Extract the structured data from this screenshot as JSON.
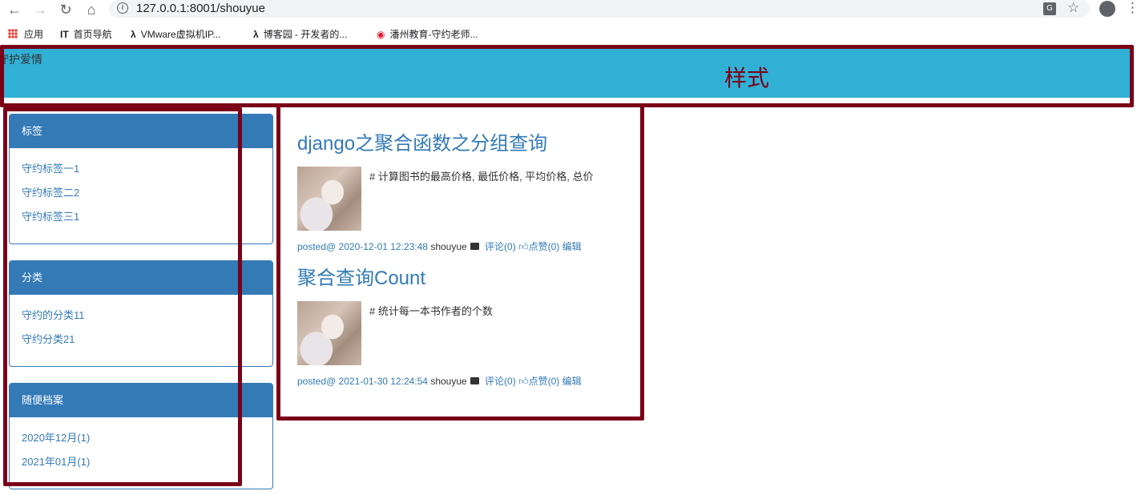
{
  "browser": {
    "url": "127.0.0.1:8001/shouyue",
    "bookmarks": [
      {
        "label": "应用",
        "icon": "apps-icon"
      },
      {
        "label": "首页导航",
        "icon": "it-icon"
      },
      {
        "label": "VMware虚拟机IP...",
        "icon": "site-icon"
      },
      {
        "label": "博客园 - 开发者的...",
        "icon": "site-icon"
      },
      {
        "label": "潘州教育-守约老师...",
        "icon": "weibo-icon"
      }
    ]
  },
  "header": {
    "brand": "守护爱情",
    "title": "样式"
  },
  "sidebar": {
    "panels": [
      {
        "title": "标签",
        "items": [
          "守约标签一1",
          "守约标签二2",
          "守约标签三1"
        ]
      },
      {
        "title": "分类",
        "items": [
          "守约的分类11",
          "守约分类21"
        ]
      },
      {
        "title": "随便档案",
        "items": [
          "2020年12月(1)",
          "2021年01月(1)"
        ]
      }
    ]
  },
  "articles": [
    {
      "title": "django之聚合函数之分组查询",
      "summary": "# 计算图书的最高价格, 最低价格, 平均价格, 总价",
      "posted": "posted@ 2020-12-01 12:23:48",
      "author": "shouyue",
      "comments": "评论(0)",
      "likes": "点赞(0)",
      "edit": "编辑"
    },
    {
      "title": "聚合查询Count",
      "summary": "# 统计每一本书作者的个数",
      "posted": "posted@ 2021-01-30 12:24:54",
      "author": "shouyue",
      "comments": "评论(0)",
      "likes": "点赞(0)",
      "edit": "编辑"
    }
  ],
  "colors": {
    "header_bg": "#31b0d5",
    "panel_primary": "#337ab7",
    "annotation": "#7a0018"
  }
}
